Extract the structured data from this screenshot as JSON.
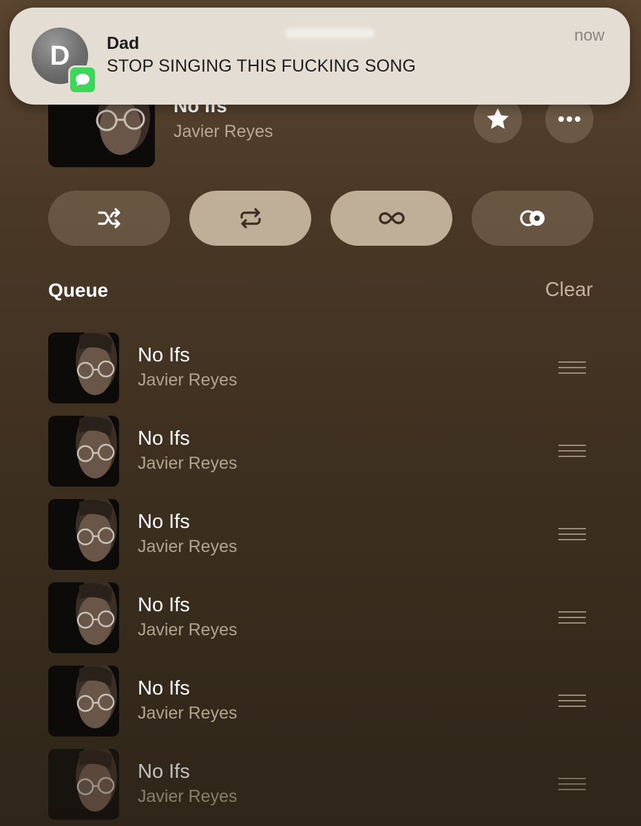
{
  "notification": {
    "avatar_initial": "D",
    "sender": "Dad",
    "message": "STOP SINGING THIS FUCKING SONG",
    "time": "now"
  },
  "now_playing": {
    "title": "No Ifs",
    "artist": "Javier Reyes"
  },
  "modes": [
    {
      "icon": "shuffle-icon",
      "active": false
    },
    {
      "icon": "repeat-icon",
      "active": true
    },
    {
      "icon": "infinity-icon",
      "active": true
    },
    {
      "icon": "crossfade-icon",
      "active": false
    }
  ],
  "queue": {
    "title": "Queue",
    "clear_label": "Clear",
    "items": [
      {
        "title": "No Ifs",
        "artist": "Javier Reyes"
      },
      {
        "title": "No Ifs",
        "artist": "Javier Reyes"
      },
      {
        "title": "No Ifs",
        "artist": "Javier Reyes"
      },
      {
        "title": "No Ifs",
        "artist": "Javier Reyes"
      },
      {
        "title": "No Ifs",
        "artist": "Javier Reyes"
      },
      {
        "title": "No Ifs",
        "artist": "Javier Reyes"
      }
    ]
  },
  "colors": {
    "accent_active": "#bfae98",
    "message_badge": "#3dd659",
    "secondary_text": "#b2a48e"
  }
}
